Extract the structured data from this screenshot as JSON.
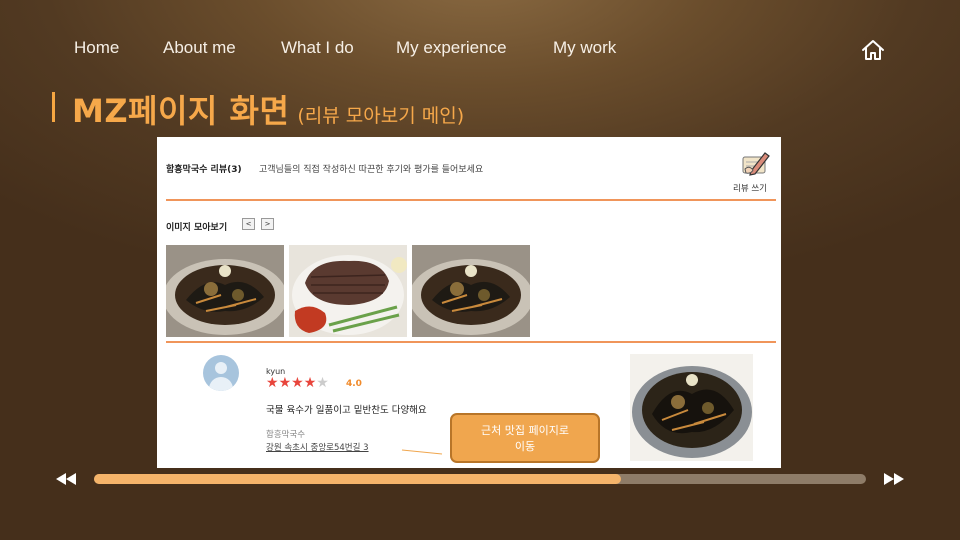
{
  "nav": {
    "items": [
      "Home",
      "About me",
      "What I do",
      "My experience",
      "My work"
    ],
    "home_icon": "home-icon"
  },
  "title": {
    "main": "MZ페이지 화면",
    "sub": "(리뷰 모아보기 메인)"
  },
  "screenshot": {
    "header_name": "함흥막국수 리뷰(3)",
    "header_desc": "고객님들의 직접 작성하신 따끈한 후기와 평가를 들어보세요",
    "write_icon": "pen-write-icon",
    "write_label": "리뷰 쓰기",
    "gallery_title": "이미지 모아보기",
    "gallery_prev": "<",
    "gallery_next": ">",
    "review": {
      "user": "kyun",
      "stars": 4,
      "rating": "4.0",
      "text": "국물 육수가 일품이고 밑반찬도 다양해요",
      "restaurant": "함흥막국수",
      "address": "강원 속초시 중앙로54번길 3"
    }
  },
  "callout": {
    "line1": "근처 맛집 페이지로",
    "line2": "이동"
  },
  "player": {
    "progress": 0.683,
    "prev_icon": "rewind-icon",
    "next_icon": "fast-forward-icon"
  },
  "colors": {
    "accent": "#f5a642",
    "progress_fill": "#f5b46a",
    "divider": "#f0955a",
    "star": "#e8453c"
  }
}
